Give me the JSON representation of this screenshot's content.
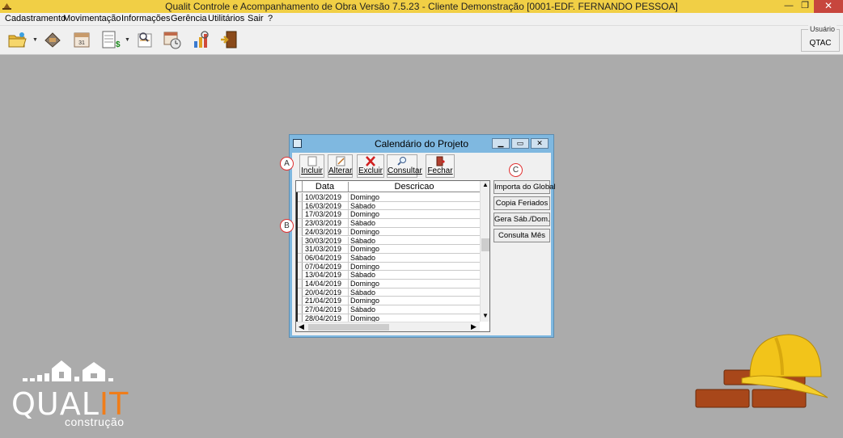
{
  "window": {
    "title": "Qualit Controle e Acompanhamento de Obra Versão 7.5.23 - Cliente Demonstração [0001-EDF. FERNANDO PESSOA]",
    "minimize_glyph": "—",
    "maximize_glyph": "❐",
    "close_glyph": "✕"
  },
  "menu": {
    "items": [
      {
        "label": "Cadastramento"
      },
      {
        "label": "Movimentação"
      },
      {
        "label": "Informações"
      },
      {
        "label": "Gerência"
      },
      {
        "label": "Utilitários"
      },
      {
        "label": "Sair"
      },
      {
        "label": "?"
      }
    ]
  },
  "toolbar": {
    "icons": [
      "folder-open-icon",
      "tools-icon",
      "calendar-icon",
      "spreadsheet-money-icon",
      "search-report-icon",
      "calendar-clock-icon",
      "chart-icon",
      "exit-door-icon"
    ]
  },
  "user": {
    "label": "Usuário",
    "value": "QTAC"
  },
  "dialog": {
    "title": "Calendário do Projeto",
    "tools": {
      "incluir": "Incluir",
      "alterar": "Alterar",
      "excluir": "Excluir",
      "consultar": "Consultar",
      "fechar": "Fechar"
    },
    "grid": {
      "col_data": "Data",
      "col_descricao": "Descricao",
      "rows": [
        {
          "date": "10/03/2019",
          "desc": "Domingo"
        },
        {
          "date": "16/03/2019",
          "desc": "Sábado"
        },
        {
          "date": "17/03/2019",
          "desc": "Domingo"
        },
        {
          "date": "23/03/2019",
          "desc": "Sábado"
        },
        {
          "date": "24/03/2019",
          "desc": "Domingo"
        },
        {
          "date": "30/03/2019",
          "desc": "Sábado"
        },
        {
          "date": "31/03/2019",
          "desc": "Domingo"
        },
        {
          "date": "06/04/2019",
          "desc": "Sábado"
        },
        {
          "date": "07/04/2019",
          "desc": "Domingo"
        },
        {
          "date": "13/04/2019",
          "desc": "Sábado"
        },
        {
          "date": "14/04/2019",
          "desc": "Domingo"
        },
        {
          "date": "20/04/2019",
          "desc": "Sábado"
        },
        {
          "date": "21/04/2019",
          "desc": "Domingo"
        },
        {
          "date": "27/04/2019",
          "desc": "Sábado"
        },
        {
          "date": "28/04/2019",
          "desc": "Domingo"
        }
      ]
    },
    "side_buttons": {
      "importa": "Importa do Global",
      "copia": "Copia Feriados",
      "gera": "Gera Sáb./Dom.",
      "consulta_mes": "Consulta Mês"
    }
  },
  "annotations": {
    "a": "A",
    "b": "B",
    "c": "C"
  },
  "logo": {
    "word_main": "QUAL",
    "word_accent": "IT",
    "subtitle": "construção"
  },
  "colors": {
    "titlebar": "#f1cf45",
    "desktop": "#ababab",
    "dialog_frame": "#7fb8e0",
    "close_red": "#c7463d",
    "logo_accent": "#f07d1a",
    "annotation_red": "#e03030"
  }
}
